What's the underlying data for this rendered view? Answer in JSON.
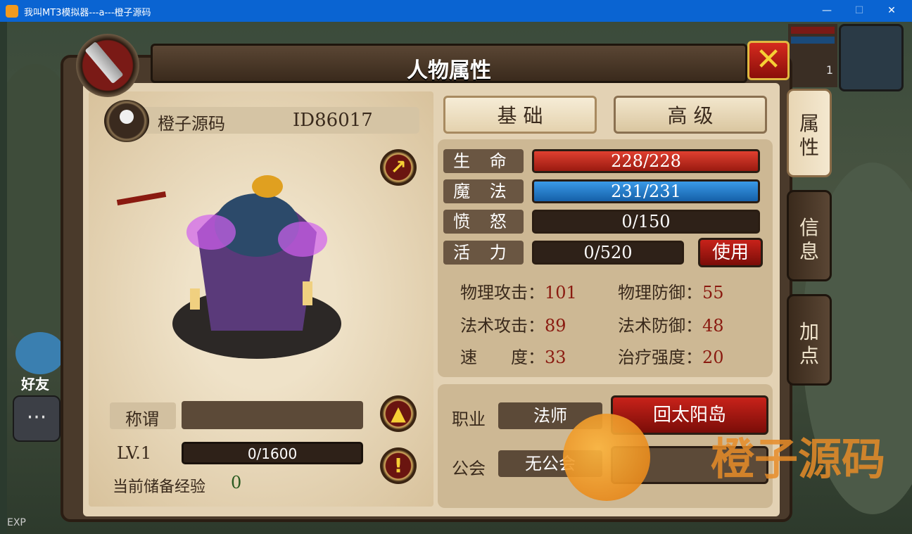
{
  "window": {
    "title": "我叫MT3模拟器---a---橙子源码"
  },
  "panel": {
    "title": "人物属性",
    "player_name": "橙子源码",
    "player_id": "ID86017",
    "title_label": "称谓",
    "title_value": "",
    "level": "LV.1",
    "exp_bar": "0/1600",
    "exp_progress": 0.0,
    "stored_exp_label": "当前储备经验",
    "stored_exp_value": "0"
  },
  "tabs": {
    "basic": "基 础",
    "advanced": "高 级"
  },
  "side_tabs": [
    "属性",
    "信息",
    "加点"
  ],
  "bars": {
    "hp_label": "生 命",
    "hp": "228/228",
    "hp_fraction": 1.0,
    "mp_label": "魔 法",
    "mp": "231/231",
    "mp_fraction": 1.0,
    "rage_label": "愤 怒",
    "rage": "0/150",
    "rage_fraction": 0.0,
    "vigor_label": "活 力",
    "vigor": "0/520",
    "vigor_fraction": 0.0,
    "use_button": "使用"
  },
  "stats": {
    "phys_atk_label": "物理攻击：",
    "phys_atk": "101",
    "phys_def_label": "物理防御：",
    "phys_def": "55",
    "mag_atk_label": "法术攻击：",
    "mag_atk": "89",
    "mag_def_label": "法术防御：",
    "mag_def": "48",
    "speed_label": "速　　度：",
    "speed": "33",
    "heal_label": "治疗强度：",
    "heal": "20"
  },
  "bottom": {
    "class_label": "职业",
    "class_value": "法师",
    "return_button": "回太阳岛",
    "guild_label": "公会",
    "guild_value": "无公会"
  },
  "hud": {
    "friends": "好友",
    "exp_tag": "EXP",
    "corner_number": "1"
  },
  "watermark": "橙子源码",
  "colors": {
    "hp": "#c8221a",
    "mp": "#1a74c8",
    "titlebar": "#0a64d2",
    "accent_red": "#8a1a10"
  }
}
